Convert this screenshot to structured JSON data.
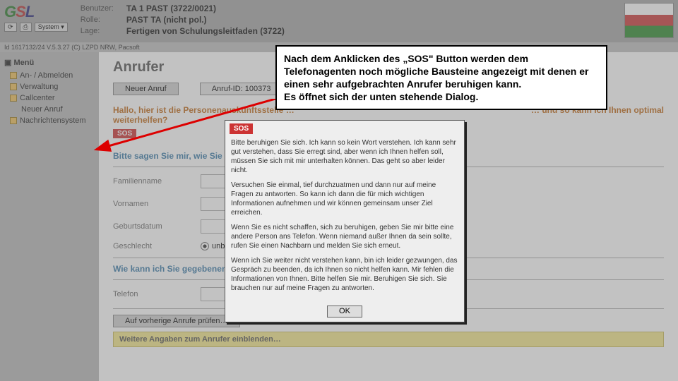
{
  "header": {
    "labels": {
      "user": "Benutzer:",
      "role": "Rolle:",
      "context": "Lage:"
    },
    "values": {
      "user": "TA 1 PAST (3722/0021)",
      "role": "PAST TA (nicht pol.)",
      "context": "Fertigen von Schulungsleitfaden (3722)"
    },
    "sysbtn": "System ▾",
    "statusbar": "Id 1617132/24 V.5.3.27 (C) LZPD NRW, Pacsoft"
  },
  "sidebar": {
    "menu_label": "Menü",
    "items": [
      {
        "label": "An- / Abmelden"
      },
      {
        "label": "Verwaltung"
      },
      {
        "label": "Callcenter"
      },
      {
        "label": "Neuer Anruf",
        "sub": true
      },
      {
        "label": "Nachrichtensystem"
      }
    ]
  },
  "main": {
    "title": "Anrufer",
    "buttons": {
      "new_call": "Neuer Anruf",
      "caller_id": "Anruf-ID: 100373"
    },
    "greeting_line1": "Hallo, hier ist die Personenauskunftsstelle …",
    "greeting_line2": "weiterhelfen?",
    "greeting_tail": "… und so kann ich Ihnen optimal",
    "sos_label": "SOS",
    "prompt_name": "Bitte sagen Sie mir, wie Sie heißen und wann Sie geboren sind.",
    "field_lastname": "Familienname",
    "field_firstname": "Vornamen",
    "field_dob": "Geburtsdatum",
    "field_gender": "Geschlecht",
    "gender_unknown": "unbekannt",
    "prompt_phone": "Wie kann ich Sie gegebenenfalls telefonisch erreichen?",
    "field_phone": "Telefon",
    "btn_prev": "Auf vorherige Anrufe prüfen…",
    "expand_more": "Weitere Angaben zum Anrufer einblenden…"
  },
  "callout": {
    "text": "Nach dem Anklicken des „SOS\" Button werden dem Telefonagenten noch mögliche Bausteine angezeigt mit denen er einen sehr aufgebrachten Anrufer beruhigen kann.\nEs öffnet sich der unten stehende Dialog."
  },
  "dialog": {
    "tag": "SOS",
    "p1": "Bitte beruhigen Sie sich. Ich kann so kein Wort verstehen. Ich kann sehr gut verstehen, dass Sie erregt sind, aber wenn ich Ihnen helfen soll, müssen Sie sich mit mir unterhalten können. Das geht so aber leider nicht.",
    "p2": "Versuchen Sie einmal, tief durchzuatmen und dann nur auf meine Fragen zu antworten. So kann ich dann die für mich wichtigen Informationen aufnehmen und wir können gemeinsam unser Ziel erreichen.",
    "p3": "Wenn Sie es nicht schaffen, sich zu beruhigen, geben Sie mir bitte eine andere Person ans Telefon. Wenn niemand außer Ihnen da sein sollte, rufen Sie einen Nachbarn und melden Sie sich erneut.",
    "p4": "Wenn ich Sie weiter nicht verstehen kann, bin ich leider gezwungen, das Gespräch zu beenden, da ich Ihnen so nicht helfen kann. Mir fehlen die Informationen von Ihnen. Bitte helfen Sie mir. Beruhigen Sie sich. Sie brauchen nur auf meine Fragen zu antworten.",
    "ok": "OK"
  }
}
